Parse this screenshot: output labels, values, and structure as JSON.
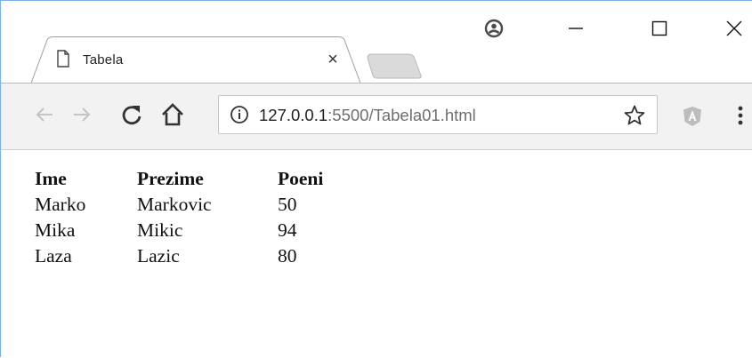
{
  "browser": {
    "tab": {
      "title": "Tabela",
      "close_glyph": "×"
    },
    "url": {
      "host": "127.0.0.1",
      "path": ":5500/Tabela01.html"
    },
    "icons": {
      "page": "page-icon",
      "close": "close-icon",
      "account": "account-icon",
      "minimize": "minimize-icon",
      "maximize": "maximize-icon",
      "window_close": "window-close-icon",
      "back": "back-arrow-icon",
      "forward": "forward-arrow-icon",
      "reload": "reload-icon",
      "home": "home-icon",
      "info": "info-icon",
      "bookmark": "star-icon",
      "extension": "angular-shield-icon",
      "menu": "menu-dots-icon"
    },
    "colors": {
      "toolbar": "#f2f2f2",
      "window_border": "#7cb3e6"
    }
  },
  "table": {
    "headers": [
      "Ime",
      "Prezime",
      "Poeni"
    ],
    "rows": [
      [
        "Marko",
        "Markovic",
        "50"
      ],
      [
        "Mika",
        "Mikic",
        "94"
      ],
      [
        "Laza",
        "Lazic",
        "80"
      ]
    ]
  }
}
